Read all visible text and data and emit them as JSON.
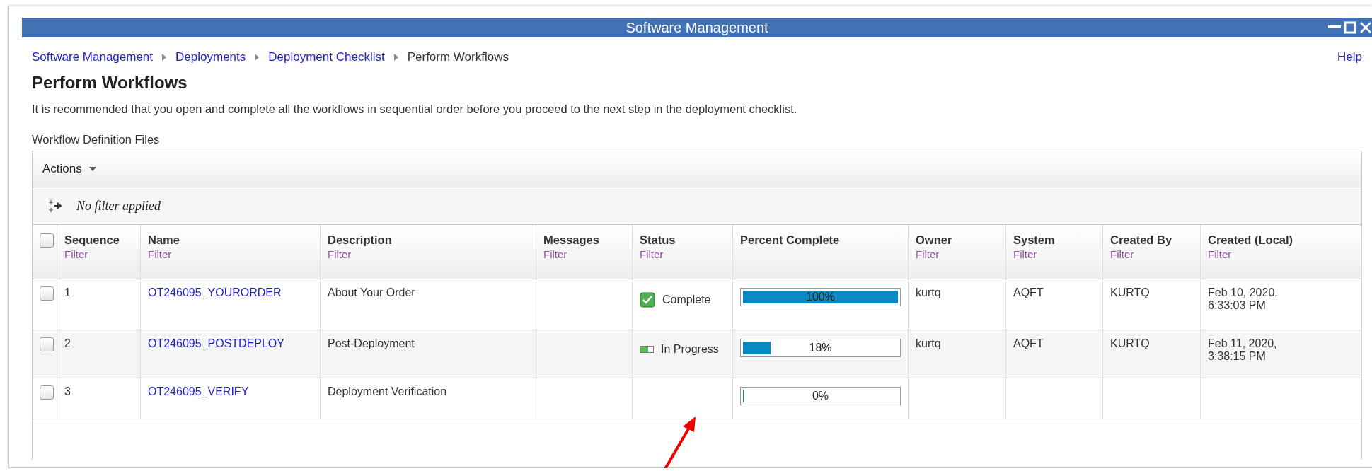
{
  "window": {
    "title": "Software Management"
  },
  "breadcrumb": [
    {
      "label": "Software Management",
      "link": true
    },
    {
      "label": "Deployments",
      "link": true
    },
    {
      "label": "Deployment Checklist",
      "link": true
    },
    {
      "label": "Perform Workflows",
      "link": false
    }
  ],
  "help": "Help",
  "heading": "Perform Workflows",
  "description": "It is recommended that you open and complete all the workflows in sequential order before you proceed to the next step in the deployment checklist.",
  "table": {
    "label": "Workflow Definition Files",
    "actions": "Actions",
    "filter_status": "No filter applied",
    "select_all": {
      "checked": false
    },
    "columns": [
      {
        "label": "Sequence",
        "filter": "Filter"
      },
      {
        "label": "Name",
        "filter": "Filter"
      },
      {
        "label": "Description",
        "filter": "Filter"
      },
      {
        "label": "Messages",
        "filter": "Filter"
      },
      {
        "label": "Status",
        "filter": "Filter"
      },
      {
        "label": "Percent Complete"
      },
      {
        "label": "Owner",
        "filter": "Filter"
      },
      {
        "label": "System",
        "filter": "Filter"
      },
      {
        "label": "Created By",
        "filter": "Filter"
      },
      {
        "label": "Created (Local)",
        "filter": "Filter"
      }
    ],
    "rows": [
      {
        "checked": false,
        "sequence": "1",
        "name": "OT246095_YOURORDER",
        "description": "About Your Order",
        "status": {
          "kind": "complete",
          "label": "Complete"
        },
        "level": 1,
        "percent": "100%",
        "owner": "kurtq",
        "system": "AQFT",
        "created_by": "KURTQ",
        "created": [
          "Feb 10, 2020,",
          "6:33:03 PM"
        ]
      },
      {
        "checked": false,
        "sequence": "2",
        "name": "OT246095_POSTDEPLOY",
        "description": "Post-Deployment",
        "status": {
          "kind": "in_progress",
          "label": "In Progress"
        },
        "level": 0.18,
        "percent": "18%",
        "owner": "kurtq",
        "system": "AQFT",
        "created_by": "KURTQ",
        "created": [
          "Feb 11, 2020,",
          "3:38:15 PM"
        ]
      },
      {
        "checked": false,
        "sequence": "3",
        "name": "OT246095_VERIFY",
        "description": "Deployment Verification",
        "level": 0,
        "percent": "0%"
      }
    ]
  }
}
